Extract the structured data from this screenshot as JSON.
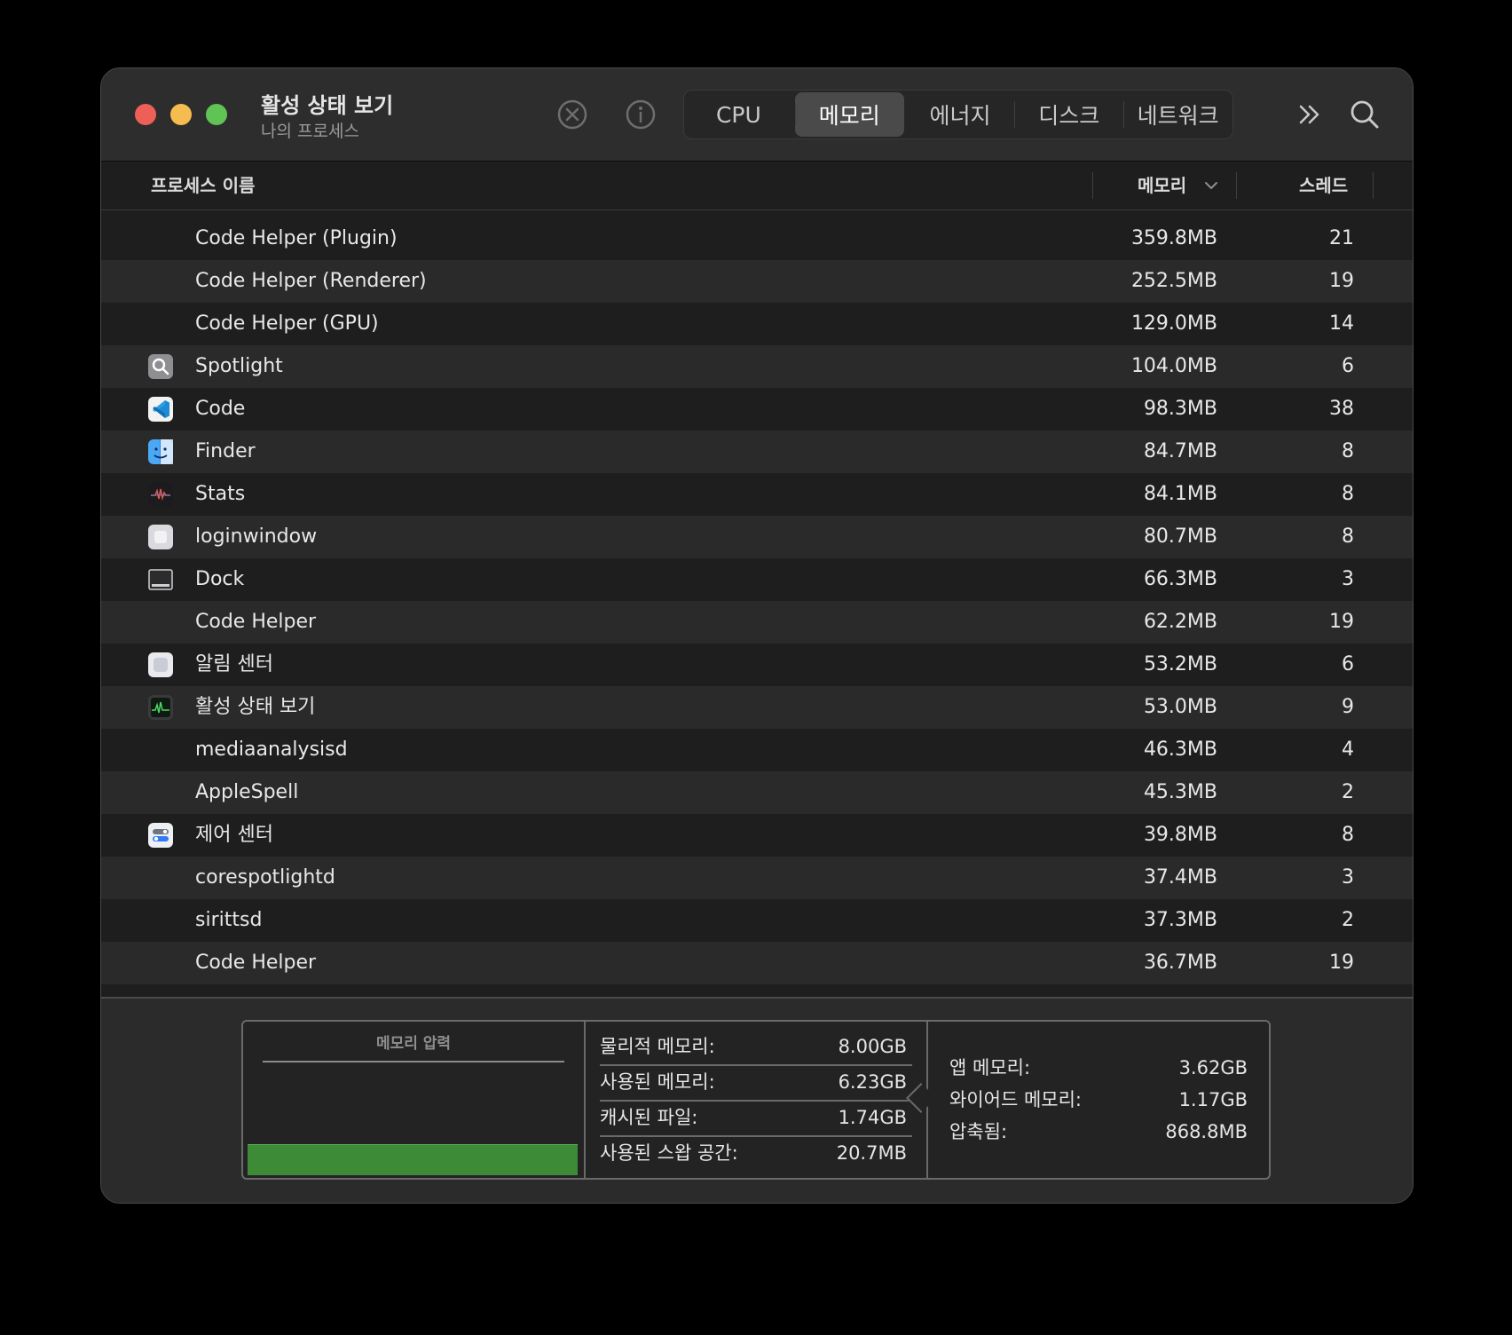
{
  "window": {
    "title": "활성 상태 보기",
    "subtitle": "나의 프로세스"
  },
  "toolbar": {
    "stop_icon": "stop-process-icon",
    "info_icon": "info-icon",
    "more_icon": "chevron-double-right-icon",
    "search_icon": "search-icon"
  },
  "tabs": [
    {
      "label": "CPU",
      "active": false
    },
    {
      "label": "메모리",
      "active": true
    },
    {
      "label": "에너지",
      "active": false
    },
    {
      "label": "디스크",
      "active": false
    },
    {
      "label": "네트워크",
      "active": false
    }
  ],
  "columns": {
    "name": "프로세스 이름",
    "memory": "메모리",
    "threads": "스레드"
  },
  "processes": [
    {
      "name": "Code Helper (Plugin)",
      "memory": "359.8MB",
      "threads": "21",
      "icon": ""
    },
    {
      "name": "Code Helper (Renderer)",
      "memory": "252.5MB",
      "threads": "19",
      "icon": ""
    },
    {
      "name": "Code Helper (GPU)",
      "memory": "129.0MB",
      "threads": "14",
      "icon": ""
    },
    {
      "name": "Spotlight",
      "memory": "104.0MB",
      "threads": "6",
      "icon": "spotlight-icon"
    },
    {
      "name": "Code",
      "memory": "98.3MB",
      "threads": "38",
      "icon": "vscode-icon"
    },
    {
      "name": "Finder",
      "memory": "84.7MB",
      "threads": "8",
      "icon": "finder-icon"
    },
    {
      "name": "Stats",
      "memory": "84.1MB",
      "threads": "8",
      "icon": "stats-icon"
    },
    {
      "name": "loginwindow",
      "memory": "80.7MB",
      "threads": "8",
      "icon": "loginwindow-icon"
    },
    {
      "name": "Dock",
      "memory": "66.3MB",
      "threads": "3",
      "icon": "dock-icon"
    },
    {
      "name": "Code Helper",
      "memory": "62.2MB",
      "threads": "19",
      "icon": ""
    },
    {
      "name": "알림 센터",
      "memory": "53.2MB",
      "threads": "6",
      "icon": "notification-center-icon"
    },
    {
      "name": "활성 상태 보기",
      "memory": "53.0MB",
      "threads": "9",
      "icon": "activity-monitor-icon"
    },
    {
      "name": "mediaanalysisd",
      "memory": "46.3MB",
      "threads": "4",
      "icon": ""
    },
    {
      "name": "AppleSpell",
      "memory": "45.3MB",
      "threads": "2",
      "icon": ""
    },
    {
      "name": "제어 센터",
      "memory": "39.8MB",
      "threads": "8",
      "icon": "control-center-icon"
    },
    {
      "name": "corespotlightd",
      "memory": "37.4MB",
      "threads": "3",
      "icon": ""
    },
    {
      "name": "sirittsd",
      "memory": "37.3MB",
      "threads": "2",
      "icon": ""
    },
    {
      "name": "Code Helper",
      "memory": "36.7MB",
      "threads": "19",
      "icon": ""
    }
  ],
  "footer": {
    "pressure_label": "메모리 압력",
    "pressure_color": "#3d8b37",
    "physical_memory_label": "물리적 메모리:",
    "physical_memory_value": "8.00GB",
    "used_memory_label": "사용된 메모리:",
    "used_memory_value": "6.23GB",
    "cached_files_label": "캐시된 파일:",
    "cached_files_value": "1.74GB",
    "swap_used_label": "사용된 스왑 공간:",
    "swap_used_value": "20.7MB",
    "app_memory_label": "앱 메모리:",
    "app_memory_value": "3.62GB",
    "wired_memory_label": "와이어드 메모리:",
    "wired_memory_value": "1.17GB",
    "compressed_label": "압축됨:",
    "compressed_value": "868.8MB"
  },
  "colors": {
    "close": "#ed5f57",
    "minimize": "#f5bd4f",
    "zoom": "#5fc454",
    "background": "#1e1e1e",
    "alternate_row": "#2a2a2a"
  }
}
